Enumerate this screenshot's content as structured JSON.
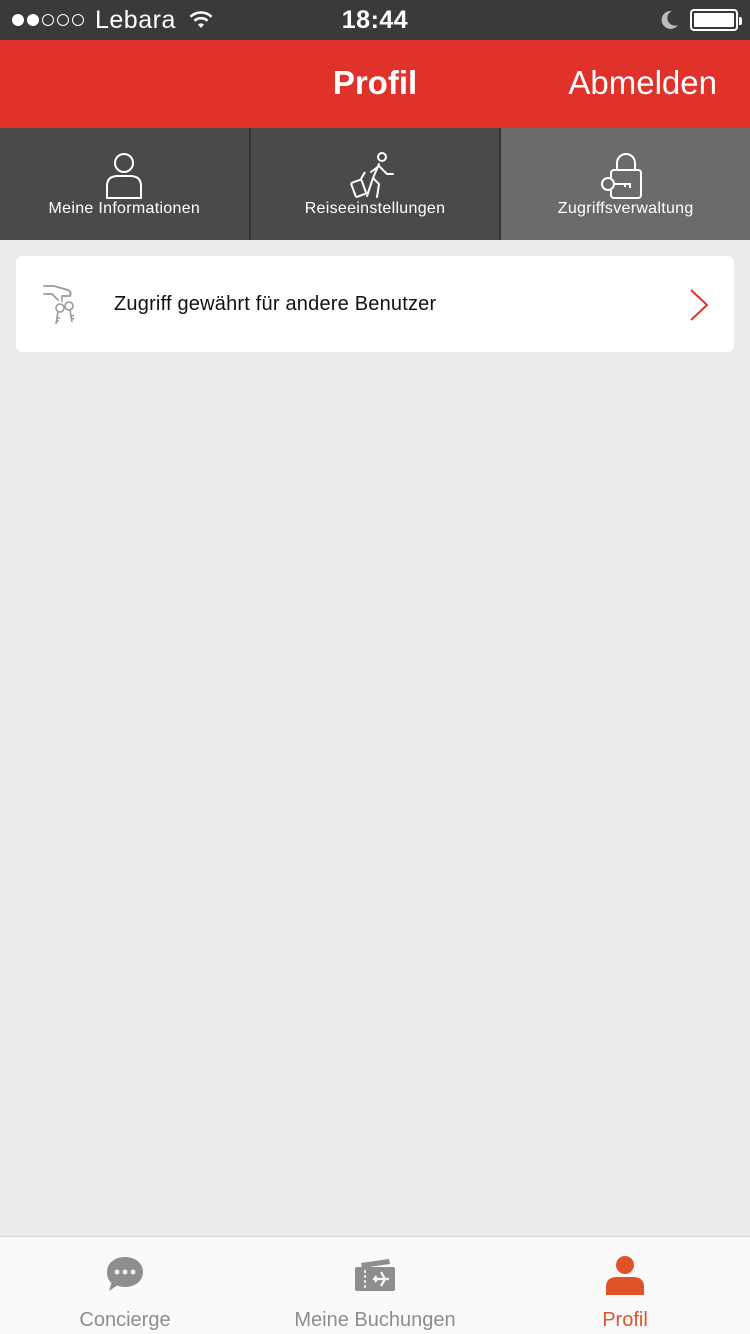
{
  "status_bar": {
    "signal_bars": [
      true,
      true,
      false,
      false,
      false
    ],
    "carrier": "Lebara",
    "time": "18:44",
    "icons": [
      "wifi-icon",
      "moon-icon",
      "battery-icon"
    ],
    "battery_level": 1.0
  },
  "header": {
    "title": "Profil",
    "logout_label": "Abmelden",
    "color": "#e0312a"
  },
  "tabs": [
    {
      "label": "Meine Informationen",
      "icon": "person-icon",
      "active": false
    },
    {
      "label": "Reiseeinstellungen",
      "icon": "traveler-luggage-icon",
      "active": false
    },
    {
      "label": "Zugriffsverwaltung",
      "icon": "padlock-key-icon",
      "active": true
    }
  ],
  "access_item": {
    "label": "Zugriff gewährt für andere Benutzer",
    "icon": "hand-keys-icon",
    "chevron_color": "#e0312a"
  },
  "tab_bar": {
    "items": [
      {
        "label": "Concierge",
        "icon": "chat-bubble-icon",
        "active": false
      },
      {
        "label": "Meine Buchungen",
        "icon": "ticket-plane-icon",
        "active": false
      },
      {
        "label": "Profil",
        "icon": "profile-person-icon",
        "active": true
      }
    ],
    "active_color": "#e0522a",
    "inactive_color": "#8e8e8e"
  }
}
